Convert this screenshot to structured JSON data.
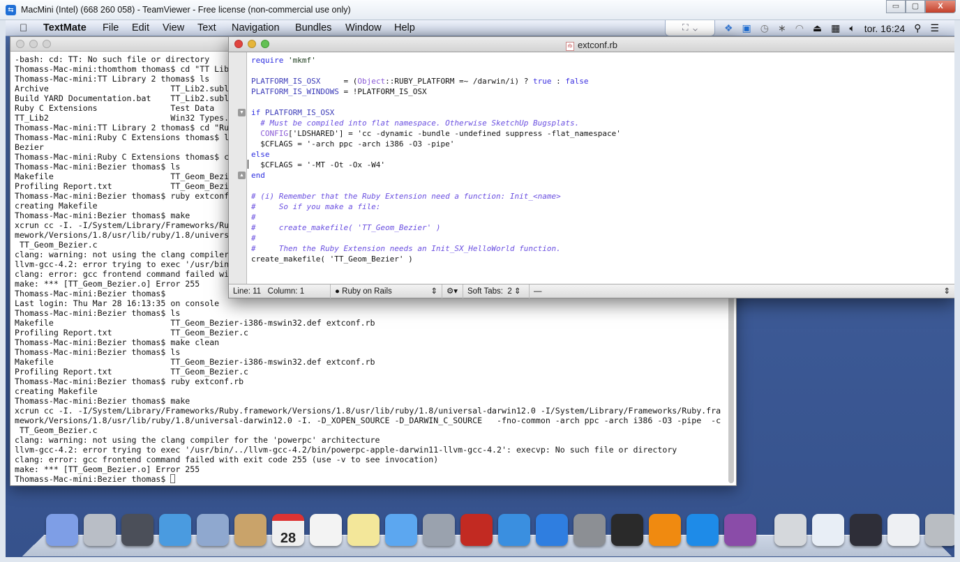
{
  "teamviewer": {
    "title": "MacMini (Intel) (668 260 058) - TeamViewer - Free license (non-commercial use only)",
    "minimize": "▭",
    "restore": "▢",
    "close": "X"
  },
  "menubar": {
    "apple": "",
    "app": "TextMate",
    "items": [
      "File",
      "Edit",
      "View",
      "Text",
      "Navigation",
      "Bundles",
      "Window",
      "Help"
    ],
    "clock": "tor. 16:24",
    "status_icons": [
      "fullscreen-icon",
      "chevron-down-icon",
      "dropbox-icon",
      "teamviewer-icon",
      "time-machine-icon",
      "bluetooth-icon",
      "wifi-icon",
      "eject-icon",
      "keyboard-viewer-icon",
      "volume-icon",
      "spotlight-icon",
      "notification-center-icon"
    ]
  },
  "terminal": {
    "lines": [
      "-bash: cd: TT: No such file or directory",
      "Thomass-Mac-mini:thomthom thomas$ cd \"TT Lib",
      "Thomass-Mac-mini:TT Library 2 thomas$ ls",
      "Archive                         TT_Lib2.subl",
      "Build YARD Documentation.bat    TT_Lib2.subl",
      "Ruby C Extensions               Test Data",
      "TT_Lib2                         Win32 Types.",
      "Thomass-Mac-mini:TT Library 2 thomas$ cd \"Ru",
      "Thomass-Mac-mini:Ruby C Extensions thomas$ l",
      "Bezier",
      "Thomass-Mac-mini:Ruby C Extensions thomas$ c",
      "Thomass-Mac-mini:Bezier thomas$ ls",
      "Makefile                        TT_Geom_Bezi",
      "Profiling Report.txt            TT_Geom_Bezi",
      "Thomass-Mac-mini:Bezier thomas$ ruby extconf",
      "creating Makefile",
      "Thomass-Mac-mini:Bezier thomas$ make",
      "xcrun cc -I. -I/System/Library/Frameworks/Ru",
      "mework/Versions/1.8/usr/lib/ruby/1.8/univers",
      " TT_Geom_Bezier.c",
      "clang: warning: not using the clang compiler",
      "llvm-gcc-4.2: error trying to exec '/usr/bin",
      "clang: error: gcc frontend command failed wi",
      "make: *** [TT_Geom_Bezier.o] Error 255",
      "Thomass-Mac-mini:Bezier thomas$",
      "Last login: Thu Mar 28 16:13:35 on console",
      "Thomass-Mac-mini:Bezier thomas$ ls",
      "Makefile                        TT_Geom_Bezier-i386-mswin32.def extconf.rb",
      "Profiling Report.txt            TT_Geom_Bezier.c",
      "Thomass-Mac-mini:Bezier thomas$ make clean",
      "Thomass-Mac-mini:Bezier thomas$ ls",
      "Makefile                        TT_Geom_Bezier-i386-mswin32.def extconf.rb",
      "Profiling Report.txt            TT_Geom_Bezier.c",
      "Thomass-Mac-mini:Bezier thomas$ ruby extconf.rb",
      "creating Makefile",
      "Thomass-Mac-mini:Bezier thomas$ make",
      "xcrun cc -I. -I/System/Library/Frameworks/Ruby.framework/Versions/1.8/usr/lib/ruby/1.8/universal-darwin12.0 -I/System/Library/Frameworks/Ruby.fra",
      "mework/Versions/1.8/usr/lib/ruby/1.8/universal-darwin12.0 -I. -D_XOPEN_SOURCE -D_DARWIN_C_SOURCE   -fno-common -arch ppc -arch i386 -O3 -pipe  -c",
      " TT_Geom_Bezier.c",
      "clang: warning: not using the clang compiler for the 'powerpc' architecture",
      "llvm-gcc-4.2: error trying to exec '/usr/bin/../llvm-gcc-4.2/bin/powerpc-apple-darwin11-llvm-gcc-4.2': execvp: No such file or directory",
      "clang: error: gcc frontend command failed with exit code 255 (use -v to see invocation)",
      "make: *** [TT_Geom_Bezier.o] Error 255"
    ],
    "prompt": "Thomass-Mac-mini:Bezier thomas$ "
  },
  "textmate": {
    "title": "extconf.rb",
    "file_icon": "rb",
    "code": [
      [
        [
          "require",
          "kw"
        ],
        [
          " 'mkmf'",
          "st"
        ]
      ],
      [],
      [
        [
          "PLATFORM_IS_OSX",
          "cn"
        ],
        [
          "     = (",
          ""
        ],
        [
          "Object",
          "ob"
        ],
        [
          "::RUBY_PLATFORM =~ /darwin/i) ? ",
          ""
        ],
        [
          "true",
          "bo"
        ],
        [
          " : ",
          ""
        ],
        [
          "false",
          "bo"
        ]
      ],
      [
        [
          "PLATFORM_IS_WINDOWS",
          "cn"
        ],
        [
          " = !PLATFORM_IS_OSX",
          ""
        ]
      ],
      [],
      [
        [
          "if",
          "kw"
        ],
        [
          " PLATFORM_IS_OSX",
          "cn"
        ]
      ],
      [
        [
          "  # Must be compiled into flat namespace. Otherwise SketchUp Bugsplats.",
          "cm"
        ]
      ],
      [
        [
          "  ",
          ""
        ],
        [
          "CONFIG",
          "ob"
        ],
        [
          "['LDSHARED'] = 'cc -dynamic -bundle -undefined suppress -flat_namespace'",
          ""
        ]
      ],
      [
        [
          "  $CFLAGS = '-arch ppc -arch i386 -O3 -pipe'",
          ""
        ]
      ],
      [
        [
          "else",
          "kw"
        ]
      ],
      [
        [
          "|",
          ""
        ],
        [
          "  $CFLAGS = '-MT -Ot -Ox -W4'",
          ""
        ]
      ],
      [
        [
          "end",
          "kw"
        ]
      ],
      [],
      [
        [
          "# (i) Remember that the Ruby Extension need a function: Init_<name>",
          "cm"
        ]
      ],
      [
        [
          "#     So if you make a file:",
          "cm"
        ]
      ],
      [
        [
          "#",
          "cm"
        ]
      ],
      [
        [
          "#     create_makefile( 'TT_Geom_Bezier' )",
          "cm"
        ]
      ],
      [
        [
          "#",
          "cm"
        ]
      ],
      [
        [
          "#     Then the Ruby Extension needs an Init_SX_HelloWorld function.",
          "cm"
        ]
      ],
      [
        [
          "create_makefile( 'TT_Geom_Bezier' )",
          ""
        ]
      ]
    ],
    "status": {
      "line": "Line: 11",
      "column": "Column: 1",
      "language": "Ruby on Rails",
      "soft_tabs": "Soft Tabs:",
      "tab_size": "2",
      "symbol": "—"
    }
  },
  "dock": {
    "items": [
      {
        "name": "finder",
        "color": "#7e9ee6"
      },
      {
        "name": "launchpad",
        "color": "#b9bec6"
      },
      {
        "name": "mission-control",
        "color": "#4b4f59"
      },
      {
        "name": "safari",
        "color": "#4a9be0"
      },
      {
        "name": "mail",
        "color": "#8fa8cf"
      },
      {
        "name": "contacts",
        "color": "#c9a36a"
      },
      {
        "name": "calendar",
        "color": "#f0f0f0"
      },
      {
        "name": "reminders",
        "color": "#f3f3f3"
      },
      {
        "name": "notes",
        "color": "#f3e79a"
      },
      {
        "name": "messages",
        "color": "#5ca7f0"
      },
      {
        "name": "facetime",
        "color": "#9aa2ae"
      },
      {
        "name": "photo-booth",
        "color": "#c22a22"
      },
      {
        "name": "itunes",
        "color": "#3a8fe0"
      },
      {
        "name": "app-store",
        "color": "#2f7ee0"
      },
      {
        "name": "system-preferences",
        "color": "#8c8f94"
      },
      {
        "name": "terminal",
        "color": "#2a2a2a"
      },
      {
        "name": "vlc",
        "color": "#f08a10"
      },
      {
        "name": "teamviewer",
        "color": "#1e8be8"
      },
      {
        "name": "textmate",
        "color": "#8a4ca8"
      },
      {
        "name": "documents-stack",
        "color": "#d5d8dc"
      },
      {
        "name": "minimized-teamviewer",
        "color": "#e8eef6"
      },
      {
        "name": "minimized-safari",
        "color": "#2e2e38"
      },
      {
        "name": "minimized-finder",
        "color": "#eef0f3"
      },
      {
        "name": "trash",
        "color": "#b9bdc2"
      }
    ],
    "calendar_day": "28"
  }
}
